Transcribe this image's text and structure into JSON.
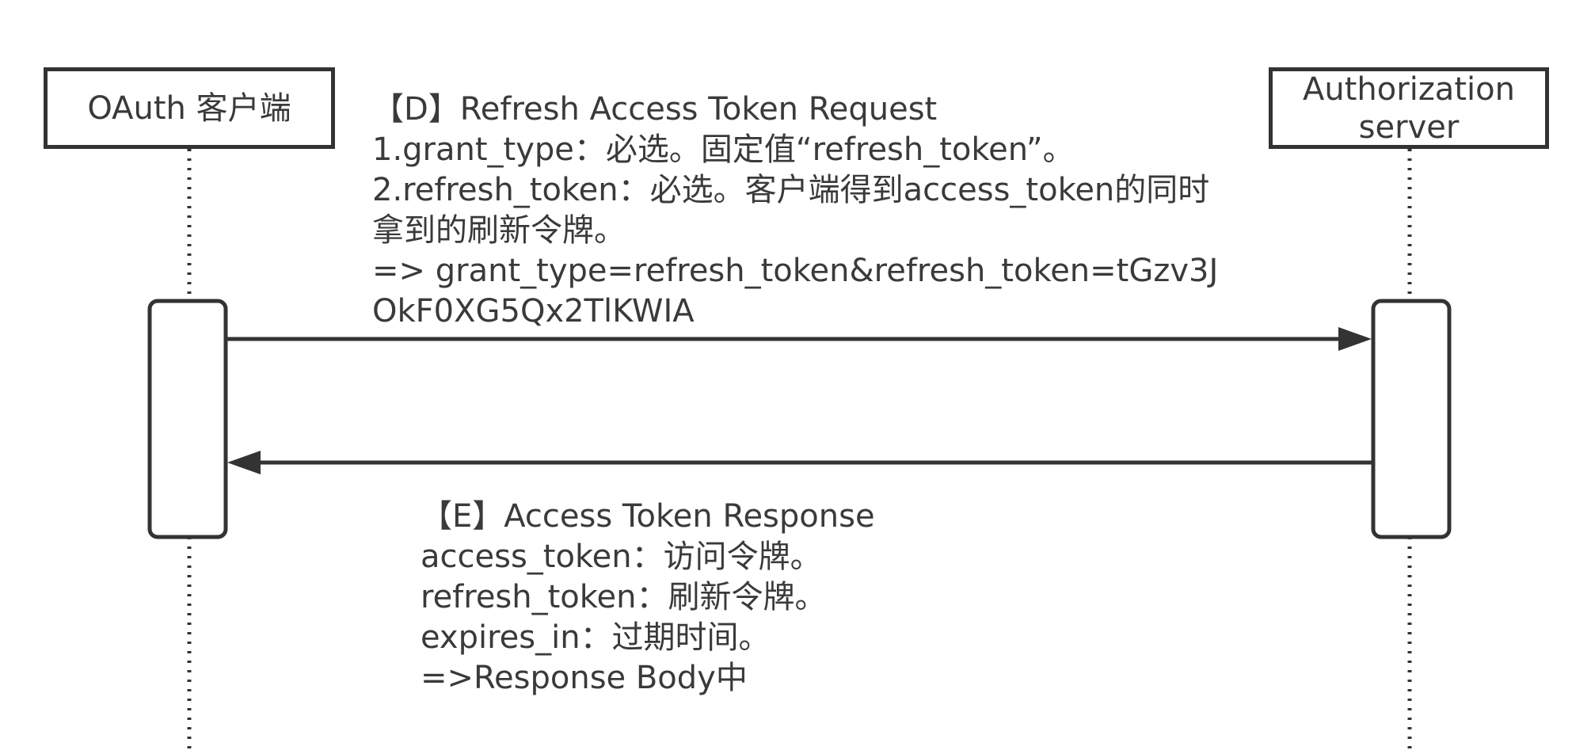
{
  "actors": {
    "client": {
      "label": "OAuth 客户端"
    },
    "server": {
      "label": "Authorization\nserver"
    }
  },
  "messages": {
    "request": {
      "lines": [
        "【D】Refresh Access Token Request",
        "1.grant_type：必选。固定值“refresh_token”。",
        "2.refresh_token：必选。客户端得到access_token的同时",
        "拿到的刷新令牌。",
        "=> grant_type=refresh_token&refresh_token=tGzv3J",
        "OkF0XG5Qx2TlKWIA"
      ]
    },
    "response": {
      "lines": [
        "【E】Access Token Response",
        "access_token：访问令牌。",
        "refresh_token：刷新令牌。",
        "expires_in：过期时间。",
        "=>Response Body中"
      ]
    }
  },
  "colors": {
    "stroke": "#333333",
    "text": "#3a3a3a",
    "background": "#ffffff"
  }
}
